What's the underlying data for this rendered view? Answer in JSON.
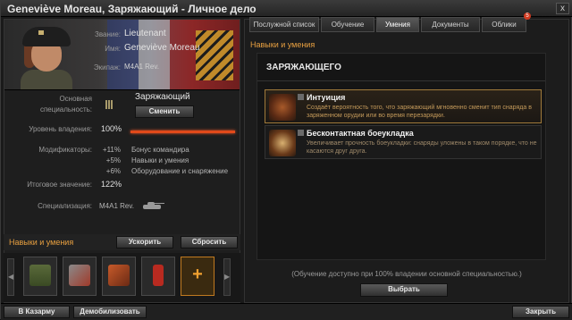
{
  "window": {
    "title": "Geneviève Moreau, Заряжающий - Личное дело",
    "close_label": "x"
  },
  "profile": {
    "rank_label": "Звание:",
    "rank_value": "Lieutenant",
    "name_label": "Имя:",
    "name_value": "Geneviève Moreau",
    "crew_label": "Экипаж:",
    "crew_value": "M4A1 Rev."
  },
  "specialty": {
    "main_label_1": "Основная",
    "main_label_2": "специальность:",
    "main_value": "Заряжающий",
    "change_button": "Сменить",
    "mastery_label": "Уровень владения:",
    "mastery_value": "100%",
    "mastery_fraction": 1.0,
    "modifiers_label": "Модификаторы:",
    "modifiers": [
      {
        "value": "+11%",
        "name": "Бонус командира"
      },
      {
        "value": "+5%",
        "name": "Навыки и умения"
      },
      {
        "value": "+6%",
        "name": "Оборудование и снаряжение"
      }
    ],
    "total_label": "Итоговое значение:",
    "total_value": "122%",
    "specialization_label": "Специализация:",
    "specialization_value": "M4A1 Rev."
  },
  "skills_panel": {
    "title": "Навыки и умения",
    "accelerate_button": "Ускорить",
    "reset_button": "Сбросить",
    "slot_icons": [
      "tank-skill-icon",
      "tools-skill-icon",
      "ammo-skill-icon",
      "extinguisher-skill-icon",
      "add-skill-icon"
    ],
    "add_label": "+"
  },
  "tabs": [
    {
      "label": "Послужной список"
    },
    {
      "label": "Обучение"
    },
    {
      "label": "Умения"
    },
    {
      "label": "Документы"
    },
    {
      "label": "Облики"
    }
  ],
  "active_tab": 2,
  "notification_count": "5",
  "right": {
    "header": "Навыки и умения",
    "section_title": "ЗАРЯЖАЮЩЕГО",
    "skills": [
      {
        "name": "Интуиция",
        "icon": "intuition-icon",
        "desc": "Создаёт вероятность того, что заряжающий мгновенно сменит тип снаряда в заряженном орудии или во время перезарядки."
      },
      {
        "name": "Бесконтактная боеукладка",
        "icon": "ammo-rack-icon",
        "desc": "Увеличивает прочность боеукладки: снаряды уложены в таком порядке, что не касаются друг друга."
      }
    ],
    "note": "(Обучение доступно при 100% владении основной специальностью.)",
    "choose_button": "Выбрать"
  },
  "bottom": {
    "barracks_button": "В Казарму",
    "demobilize_button": "Демобилизовать",
    "close_button": "Закрыть"
  },
  "colors": {
    "accent": "#e8a040",
    "mastery_bar": "#e24a1a",
    "skill_desc": "#c49a5a"
  }
}
